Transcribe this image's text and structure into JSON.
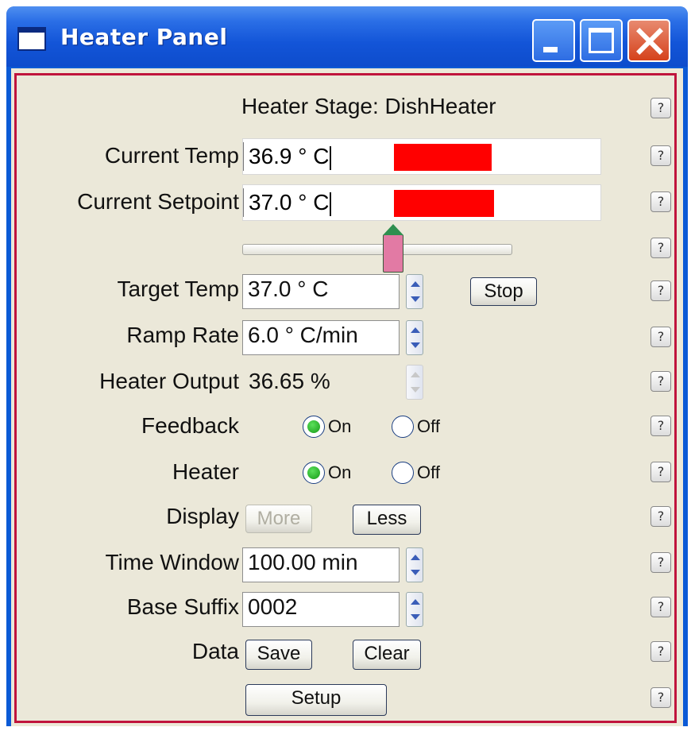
{
  "window": {
    "title": "Heater Panel"
  },
  "stage": {
    "text": "Heater Stage: DishHeater"
  },
  "current_temp": {
    "label": "Current Temp",
    "value": "36.9 ° C",
    "fill_fraction": 0.47
  },
  "current_setpoint": {
    "label": "Current Setpoint",
    "value": "37.0 ° C",
    "fill_fraction": 0.48
  },
  "setpoint_slider": {
    "position_fraction": 0.56
  },
  "target_temp": {
    "label": "Target Temp",
    "value": "37.0 ° C"
  },
  "stop_button": {
    "label": "Stop"
  },
  "ramp_rate": {
    "label": "Ramp Rate",
    "value": "6.0 ° C/min"
  },
  "heater_output": {
    "label": "Heater Output",
    "value": "36.65 %"
  },
  "feedback": {
    "label": "Feedback",
    "on_label": "On",
    "off_label": "Off",
    "selected": "On"
  },
  "heater": {
    "label": "Heater",
    "on_label": "On",
    "off_label": "Off",
    "selected": "On"
  },
  "display": {
    "label": "Display",
    "more_label": "More",
    "less_label": "Less"
  },
  "time_window": {
    "label": "Time Window",
    "value": "100.00 min"
  },
  "base_suffix": {
    "label": "Base Suffix",
    "value": "0002"
  },
  "data": {
    "label": "Data",
    "save_label": "Save",
    "clear_label": "Clear"
  },
  "setup": {
    "label": "Setup"
  },
  "help": {
    "glyph": "?"
  },
  "colors": {
    "bar_fill": "#ff0000",
    "panel_border": "#c0143c",
    "titlebar": "#0d4ccc"
  }
}
